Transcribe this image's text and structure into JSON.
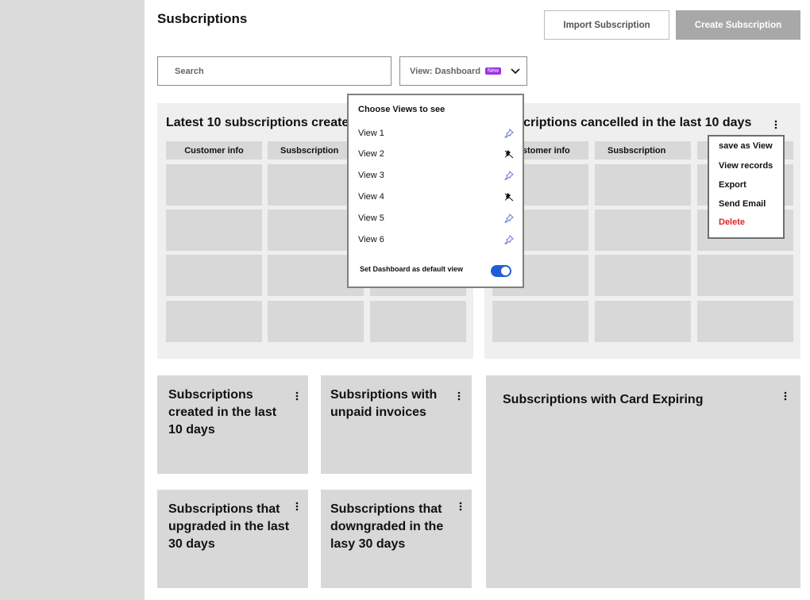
{
  "page": {
    "title": "Susbcriptions"
  },
  "header": {
    "import_label": "Import Subscription",
    "create_label": "Create Subscription"
  },
  "search": {
    "placeholder": "Search"
  },
  "view_select": {
    "label": "View: Dashboard",
    "badge": "New",
    "icon": "chevron-down-icon"
  },
  "panels": {
    "latest": {
      "title": "Latest 10 subscriptions created",
      "columns": [
        "Customer info",
        "Susbscription",
        ""
      ]
    },
    "cancelled": {
      "title": "Subscriptions cancelled in the last 10 days",
      "columns": [
        "Customer info",
        "Susbscription",
        ""
      ]
    }
  },
  "cards": {
    "created": "Subscriptions created in the last 10 days",
    "unpaid": "Subsriptions with unpaid invoices",
    "card_expiring": "Subscriptions with Card Expiring",
    "upgraded": "Subscriptions that upgraded in the last 30 days",
    "downgraded": "Subscriptions that downgraded in the lasy 30 days"
  },
  "views_dropdown": {
    "heading": "Choose Views to see",
    "items": [
      {
        "label": "View 1",
        "pinned": false
      },
      {
        "label": "View 2",
        "pinned": true
      },
      {
        "label": "View 3",
        "pinned": false
      },
      {
        "label": "View 4",
        "pinned": true
      },
      {
        "label": "View 5",
        "pinned": false
      },
      {
        "label": "View 6",
        "pinned": false
      }
    ],
    "default_label": "Set Dashboard as default view",
    "default_on": true
  },
  "context_menu": {
    "items": [
      "save as View",
      "View records",
      "Export",
      "Send Email",
      "Delete"
    ]
  },
  "colors": {
    "accent": "#9b30e8",
    "toggle": "#1f5fd6",
    "danger": "#e02424"
  }
}
